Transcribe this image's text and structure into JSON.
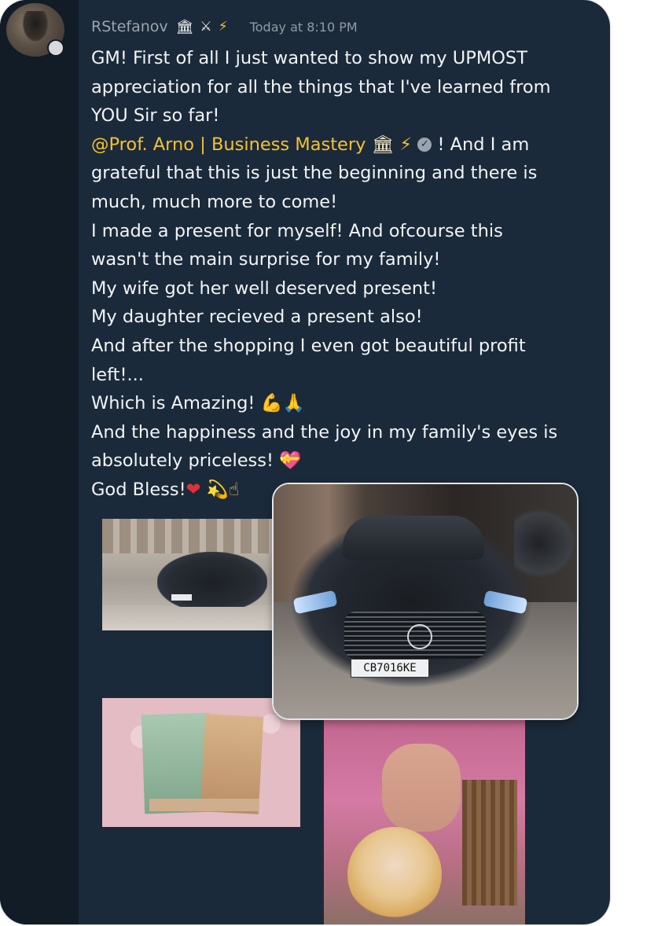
{
  "message": {
    "username": "RStefanov",
    "user_badges": [
      "bank-icon",
      "crossed-swords-icon",
      "lightning-icon"
    ],
    "timestamp": "Today at 8:10 PM",
    "lines": [
      "GM! First of all I just wanted to show my UPMOST",
      "appreciation for all the things that I've learned from",
      "YOU Sir so far!"
    ],
    "mention": "@Prof. Arno | Business Mastery",
    "mention_suffix": "! And I am",
    "lines2": [
      "grateful that this is just the beginning and there is",
      "much, much more to come!",
      "I made a present for myself! And ofcourse this",
      "wasn't the main surprise for my family!",
      "My wife got her well deserved present!",
      "My daughter recieved a present also!",
      "And after the shopping I even got beautiful profit",
      "left!..."
    ],
    "amazing": "Which is Amazing!",
    "lines3": [
      "And the happiness and the joy in my family's eyes is"
    ],
    "priceless": "absolutely priceless!",
    "closing": "God Bless!"
  },
  "photos": {
    "car_plate": "CB7016KE"
  },
  "colors": {
    "card_bg": "#1b2a3a",
    "gutter_bg": "#121c27",
    "mention": "#f6c12e",
    "text": "#f2f4f6",
    "username": "#9aa4af"
  }
}
